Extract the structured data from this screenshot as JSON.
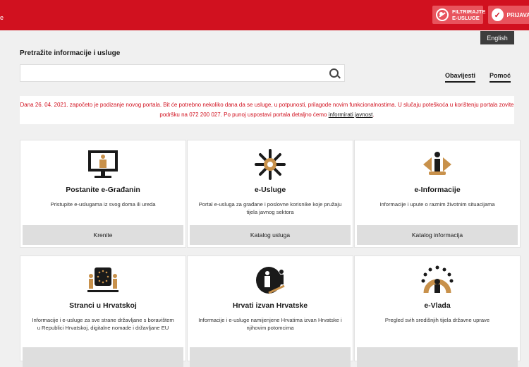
{
  "header": {
    "logo_fragment": "e",
    "filter_label": "FILTRIRAJTE E-USLUGE",
    "login_label": "PRIJAVA",
    "language": "English"
  },
  "search": {
    "title": "Pretražite informacije i usluge",
    "placeholder": "",
    "value": ""
  },
  "nav": {
    "notices": "Obavijesti",
    "help": "Pomoć"
  },
  "notice": {
    "text": "Dana 26. 04. 2021. započeto je podizanje novog portala. Bit će potrebno nekoliko dana da se usluge, u potpunosti, prilagode novim funkcionalnostima. U slučaju poteškoća u korištenju portala zovite podršku na 072 200 027. Po punoj uspostavi portala detaljno ćemo ",
    "link": "informirati javnost",
    "end": "."
  },
  "cards": [
    {
      "title": "Postanite e-Građanin",
      "desc": "Pristupite e-uslugama iz svog doma ili ureda",
      "button": "Krenite",
      "icon": "computer-citizen-icon"
    },
    {
      "title": "e-Usluge",
      "desc": "Portal e-usluga za građane i poslovne korisnike koje pružaju tijela javnog sektora",
      "button": "Katalog usluga",
      "icon": "services-burst-icon"
    },
    {
      "title": "e-Informacije",
      "desc": "Informacije i upute o raznim životnim situacijama",
      "button": "Katalog informacija",
      "icon": "info-person-icon"
    },
    {
      "title": "Stranci u Hrvatskoj",
      "desc": "Informacije i e-usluge za sve strane državljane s boravištem u Republici Hrvatskoj, digitalne nomade i državljane EU",
      "button": "",
      "icon": "eu-foreigners-icon"
    },
    {
      "title": "Hrvati izvan Hrvatske",
      "desc": "Informacije i e-usluge namijenjene Hrvatima izvan Hrvatske i njihovim potomcima",
      "button": "",
      "icon": "croats-abroad-icon"
    },
    {
      "title": "e-Vlada",
      "desc": "Pregled svih središnjih tijela državne uprave",
      "button": "",
      "icon": "government-icon"
    }
  ]
}
